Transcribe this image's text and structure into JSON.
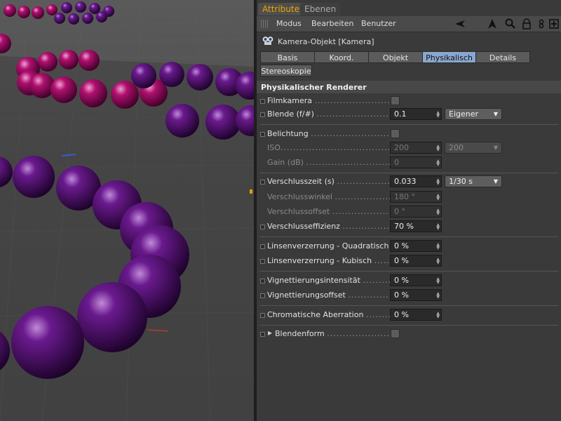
{
  "top_tabs": {
    "attribute": "Attribute",
    "layers": "Ebenen"
  },
  "menu": {
    "mode": "Modus",
    "edit": "Bearbeiten",
    "user": "Benutzer"
  },
  "object_title": "Kamera-Objekt [Kamera]",
  "tabs": [
    "Basis",
    "Koord.",
    "Objekt",
    "Physikalisch",
    "Details",
    "Stereoskopie"
  ],
  "active_tab": "Physikalisch",
  "section_title": "Physikalischer Renderer",
  "dots": "......................................",
  "rows": {
    "filmkamera": {
      "label": "Filmkamera"
    },
    "blende": {
      "label": "Blende (f/#)",
      "value": "0.1",
      "dropdown": "Eigener"
    },
    "belichtung": {
      "label": "Belichtung"
    },
    "iso": {
      "label": "ISO",
      "value": "200",
      "dropdown": "200"
    },
    "gain": {
      "label": "Gain (dB)",
      "value": "0"
    },
    "verschlusszeit": {
      "label": "Verschlusszeit (s)",
      "value": "0.033",
      "dropdown": "1/30 s"
    },
    "verschlusswinkel": {
      "label": "Verschlusswinkel",
      "value": "180 °"
    },
    "verschlussoffset": {
      "label": "Verschlussoffset",
      "value": "0 °"
    },
    "verschlusseffizienz": {
      "label": "Verschlusseffizienz",
      "value": "70 %"
    },
    "quadratisch": {
      "label": "Linsenverzerrung - Quadratisch",
      "value": "0 %"
    },
    "kubisch": {
      "label": "Linsenverzerrung - Kubisch",
      "value": "0 %"
    },
    "vig_int": {
      "label": "Vignettierungsintensität",
      "value": "0 %"
    },
    "vig_off": {
      "label": "Vignettierungsoffset",
      "value": "0 %"
    },
    "chromatic": {
      "label": "Chromatische Aberration",
      "value": "0 %"
    },
    "blendenform": {
      "label": "Blendenform"
    }
  },
  "colors": {
    "accent_tab": "#f0a400",
    "active_tab": "#8aa7cf",
    "sphere_purple": "#4a0a66",
    "sphere_magenta": "#b0106f"
  }
}
